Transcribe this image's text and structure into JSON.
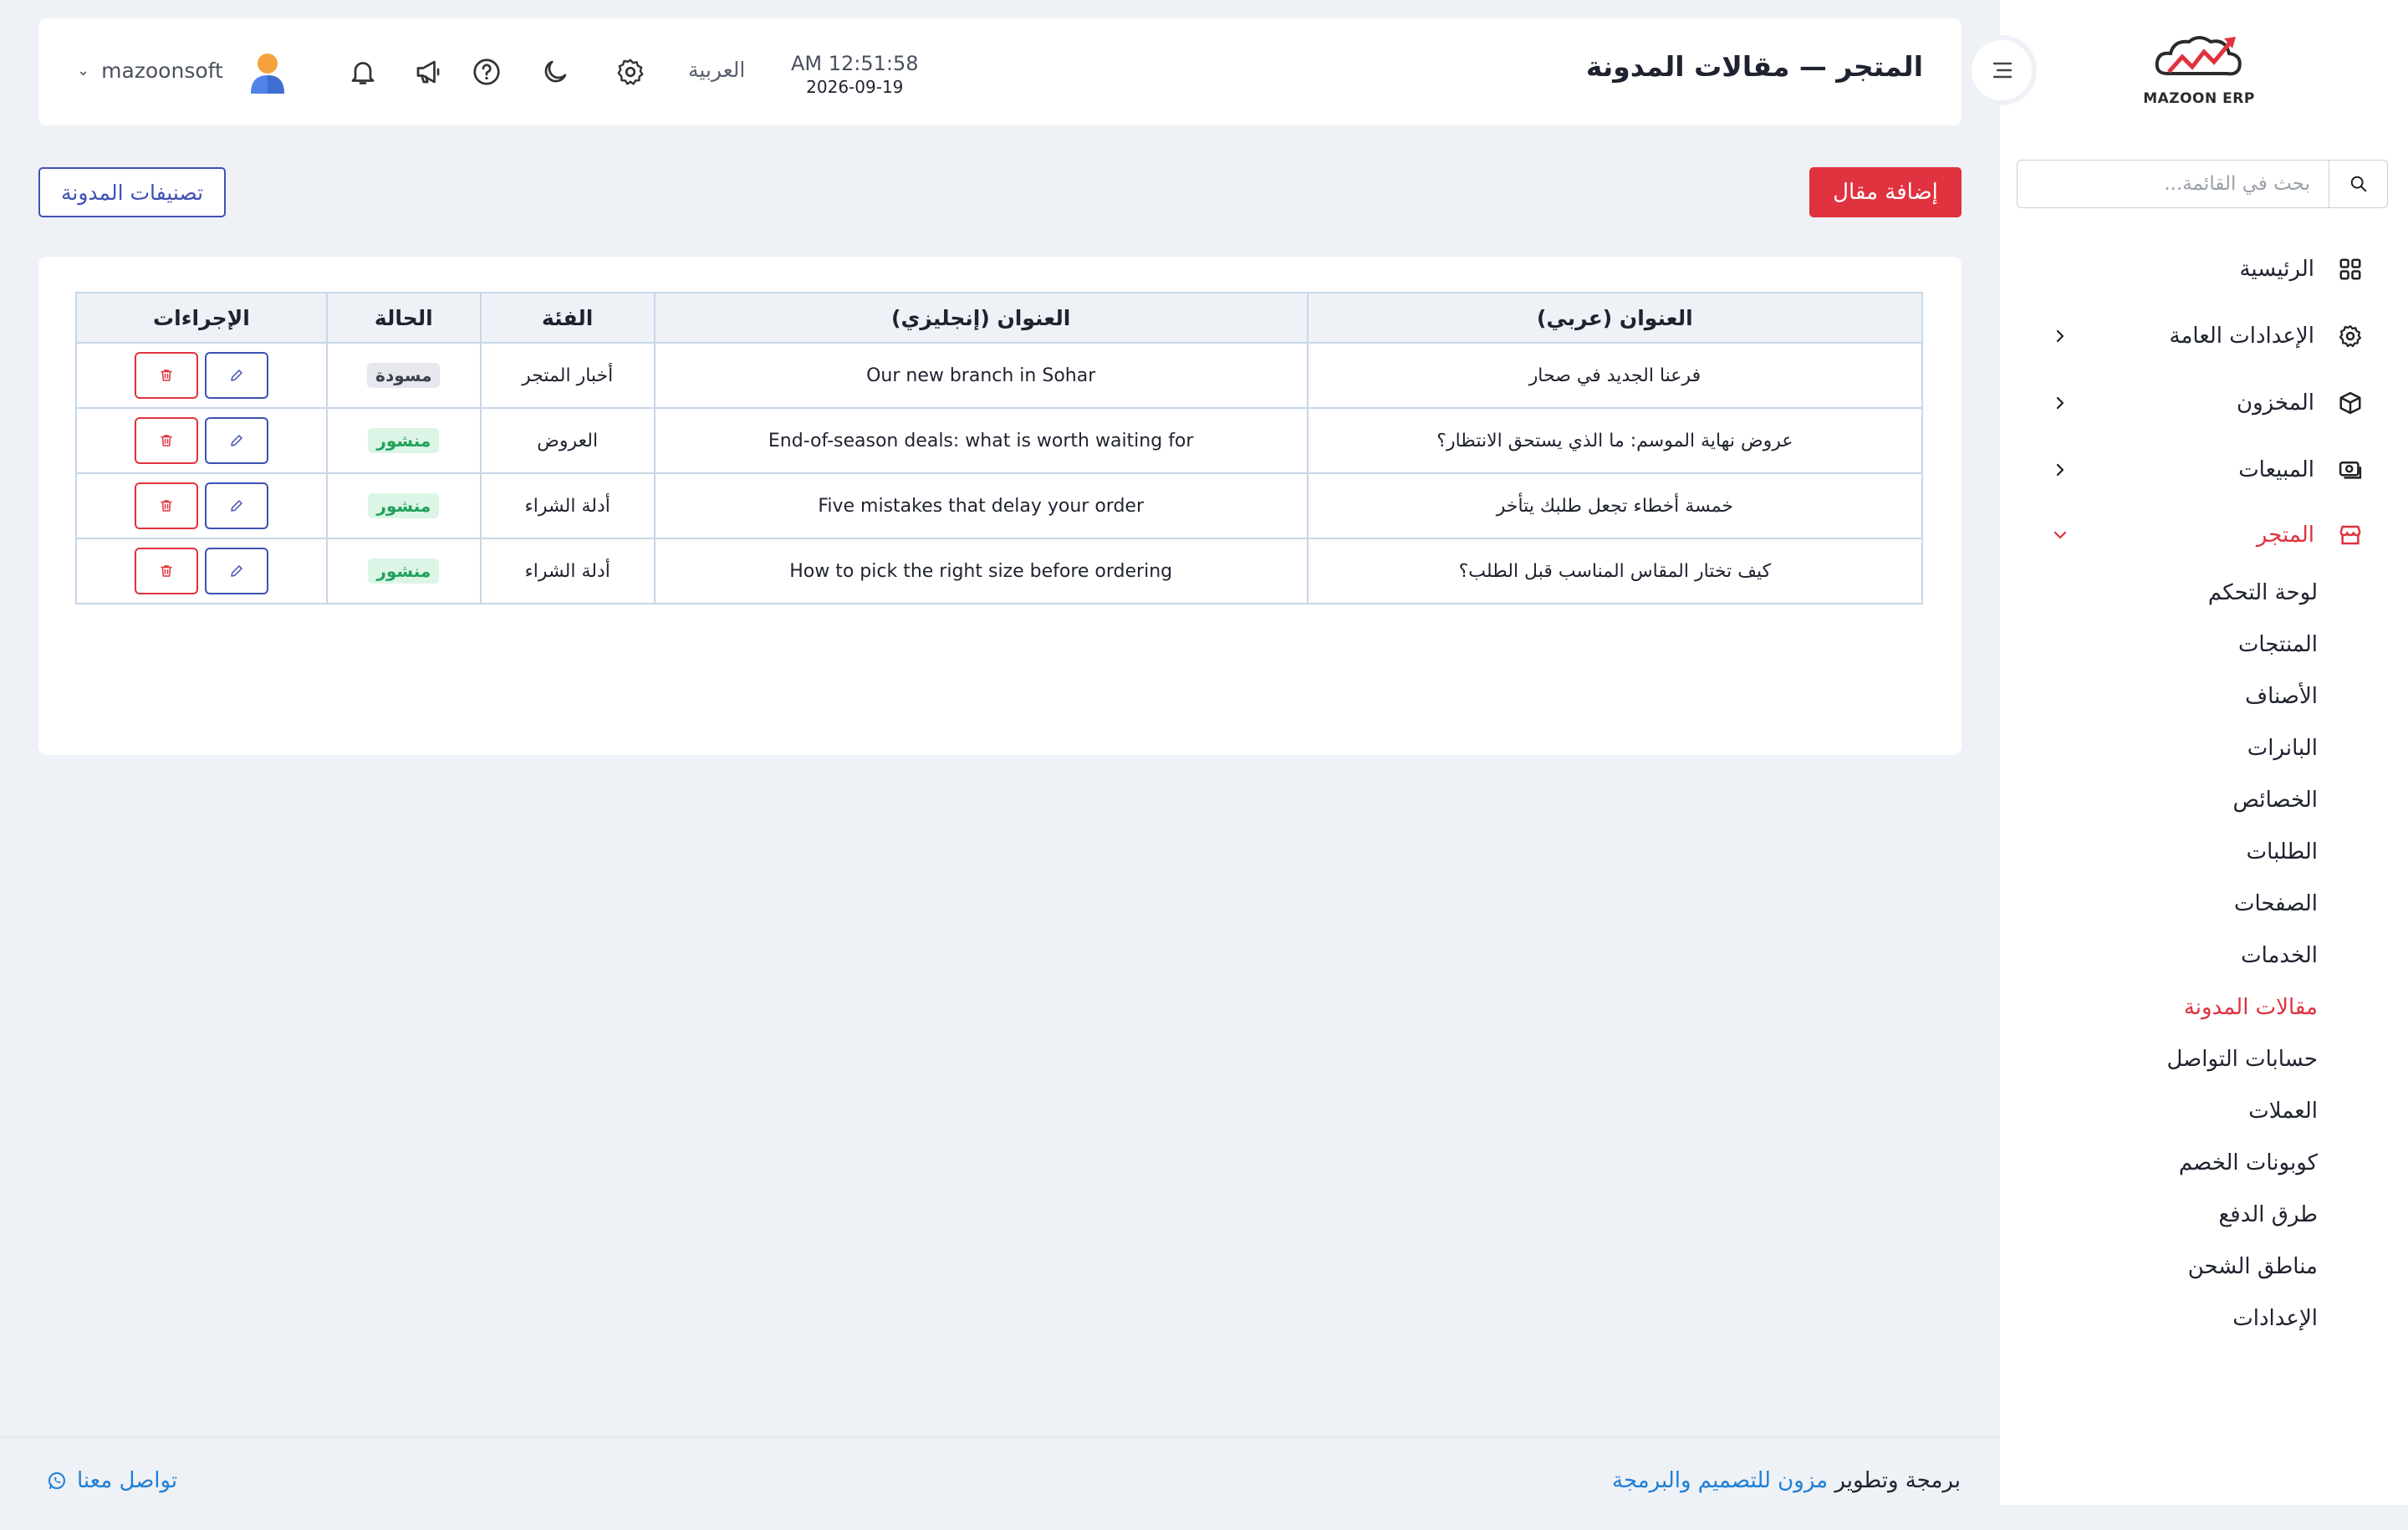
{
  "sidebar": {
    "logo_text": "MAZOON ERP",
    "search_placeholder": "بحث في القائمة...",
    "items": [
      {
        "label": "الرئيسية"
      },
      {
        "label": "الإعدادات العامة"
      },
      {
        "label": "المخزون"
      },
      {
        "label": "المبيعات"
      },
      {
        "label": "المتجر"
      }
    ],
    "store_sub_items": [
      {
        "label": "لوحة التحكم"
      },
      {
        "label": "المنتجات"
      },
      {
        "label": "الأصناف"
      },
      {
        "label": "البانرات"
      },
      {
        "label": "الخصائص"
      },
      {
        "label": "الطلبات"
      },
      {
        "label": "الصفحات"
      },
      {
        "label": "الخدمات"
      },
      {
        "label": "مقالات المدونة"
      },
      {
        "label": "حسابات التواصل"
      },
      {
        "label": "العملات"
      },
      {
        "label": "كوبونات الخصم"
      },
      {
        "label": "طرق الدفع"
      },
      {
        "label": "مناطق الشحن"
      },
      {
        "label": "الإعدادات"
      }
    ]
  },
  "header": {
    "title": "المتجر — مقالات المدونة",
    "time": "AM 12:51:58",
    "date": "2026-09-19",
    "language": "العربية",
    "username": "mazoonsoft"
  },
  "toolbar": {
    "add_label": "إضافة مقال",
    "categories_label": "تصنيفات المدونة"
  },
  "table": {
    "columns": {
      "title_ar": "العنوان (عربي)",
      "title_en": "العنوان (إنجليزي)",
      "category": "الفئة",
      "status": "الحالة",
      "actions": "الإجراءات"
    },
    "rows": [
      {
        "title_ar": "فرعنا الجديد في صحار",
        "title_en": "Our new branch in Sohar",
        "category": "أخبار المتجر",
        "status": "مسودة"
      },
      {
        "title_ar": "عروض نهاية الموسم: ما الذي يستحق الانتظار؟",
        "title_en": "End-of-season deals: what is worth waiting for",
        "category": "العروض",
        "status": "منشور"
      },
      {
        "title_ar": "خمسة أخطاء تجعل طلبك يتأخر",
        "title_en": "Five mistakes that delay your order",
        "category": "أدلة الشراء",
        "status": "منشور"
      },
      {
        "title_ar": "كيف تختار المقاس المناسب قبل الطلب؟",
        "title_en": "How to pick the right size before ordering",
        "category": "أدلة الشراء",
        "status": "منشور"
      }
    ]
  },
  "footer": {
    "credit_prefix": "برمجة وتطوير",
    "credit_link": "مزون للتصميم والبرمجة",
    "contact": "تواصل معنا"
  },
  "colors": {
    "accent_red": "#e0323f",
    "primary_blue": "#3f51b5",
    "link_blue": "#1f7fd6",
    "published_green": "#1fa35a"
  }
}
